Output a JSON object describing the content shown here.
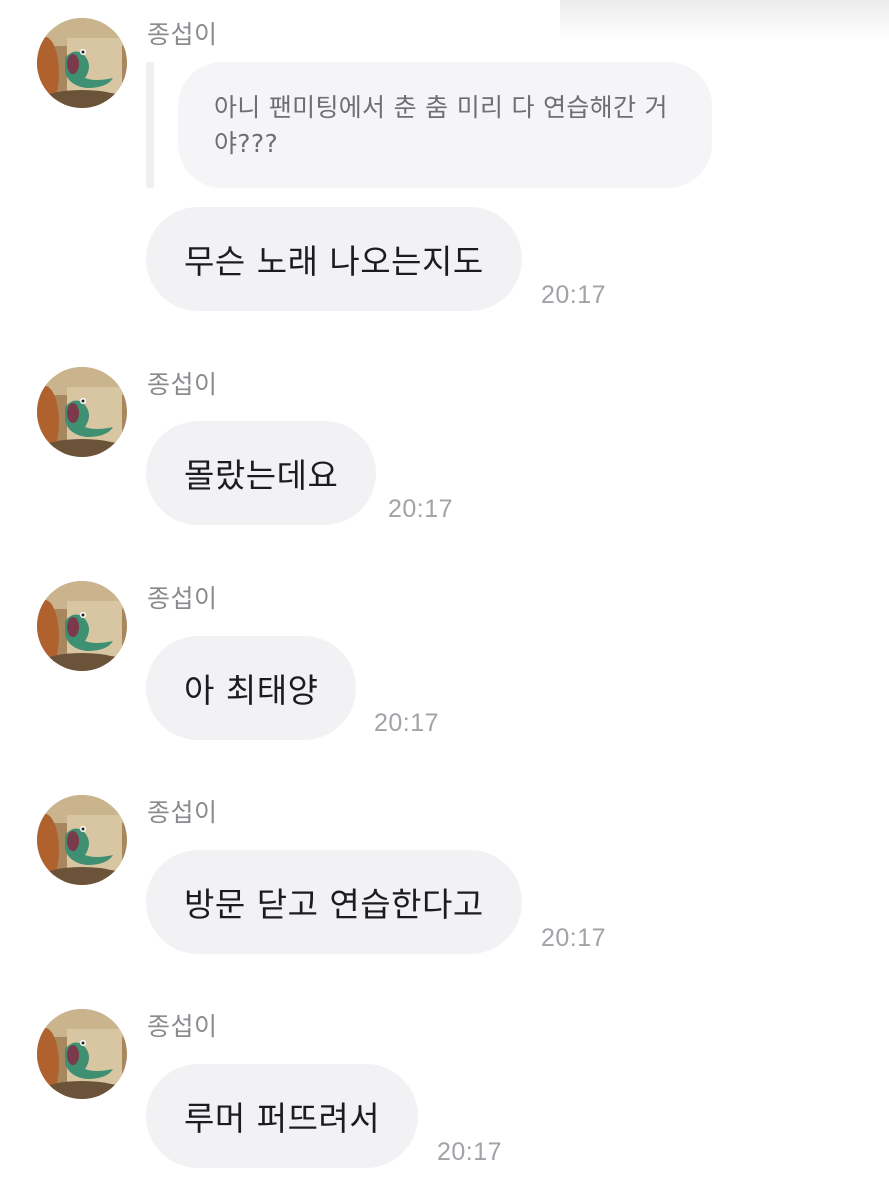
{
  "chat": {
    "reply_quote": "아니 팬미팅에서 춘 춤 미리 다 연습해간 거야???",
    "messages": [
      {
        "sender": "종섭이",
        "text": "무슨 노래 나오는지도",
        "time": "20:17"
      },
      {
        "sender": "종섭이",
        "text": "몰랐는데요",
        "time": "20:17"
      },
      {
        "sender": "종섭이",
        "text": "아 최태양",
        "time": "20:17"
      },
      {
        "sender": "종섭이",
        "text": "방문 닫고 연습한다고",
        "time": "20:17"
      },
      {
        "sender": "종섭이",
        "text": "루머 퍼뜨려서",
        "time": "20:17"
      }
    ]
  },
  "colors": {
    "bubble": "#f2f2f5",
    "quote_bubble": "#f5f5f8",
    "sender_text": "#8a8a8f",
    "timestamp": "#a2a2a8",
    "message_text": "#1c1c1e"
  },
  "icons": {
    "avatar": "green-lizard-avatar-icon"
  }
}
